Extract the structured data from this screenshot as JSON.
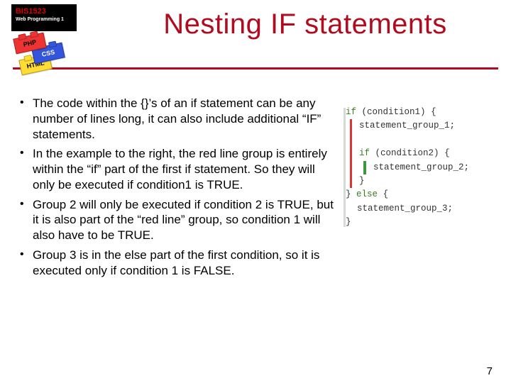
{
  "course": {
    "code": "BIS1523",
    "name": "Web Programming 1"
  },
  "bricks": {
    "red": "PHP",
    "blue": "CSS",
    "yellow": "HTML"
  },
  "title": "Nesting IF statements",
  "bullets": [
    "The code within the {}’s of an if statement can be any number of lines long, it can also include additional “IF” statements.",
    "In the example to the right, the red line group is entirely within the “if” part of the first if statement.  So they will only be executed if condition1 is TRUE.",
    "Group 2 will only be executed if condition 2 is TRUE, but it is also part of the “red line” group, so condition 1 will also have to be TRUE.",
    "Group 3 is in the else part of the first condition, so it is executed only if condition 1 is FALSE."
  ],
  "code": {
    "if": "if",
    "else": "else",
    "cond1": "(condition1)",
    "cond2": "(condition2)",
    "stmt1": "statement_group_1;",
    "stmt2": "statement_group_2;",
    "stmt3": "statement_group_3;",
    "lbrace": "{",
    "rbrace": "}"
  },
  "page_number": "7"
}
